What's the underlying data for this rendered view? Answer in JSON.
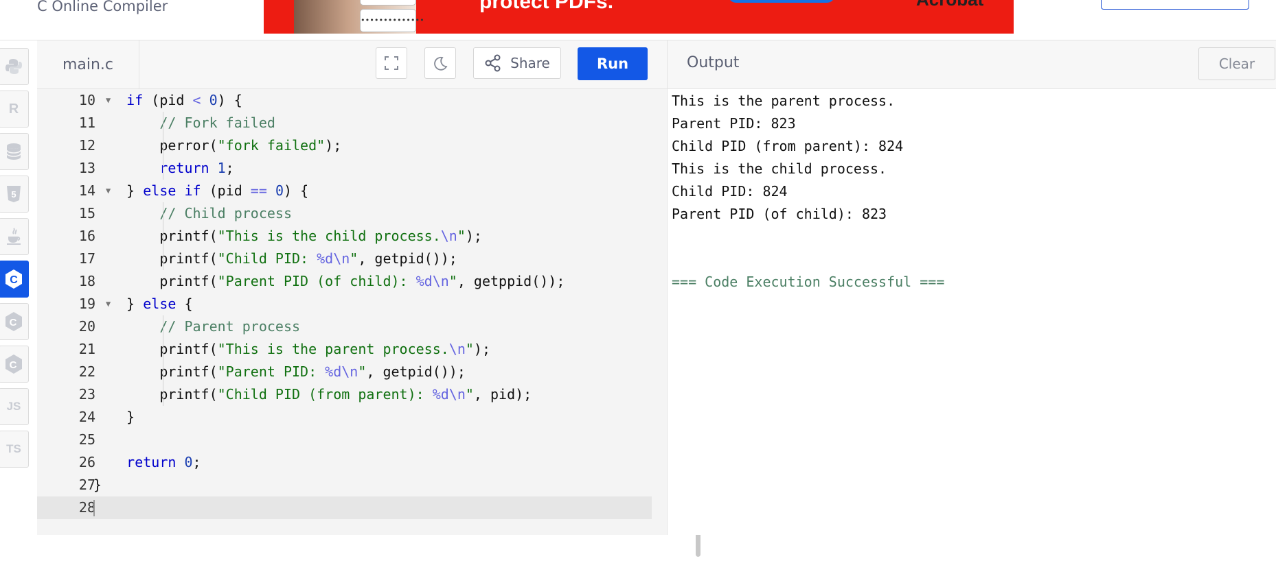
{
  "header": {
    "brand": "C Online Compiler"
  },
  "ad": {
    "headline": "protect PDFs.",
    "brand": "Acrobat",
    "password_mask": "••••••••••••••"
  },
  "sidebar": {
    "items": [
      {
        "name": "python",
        "label": "",
        "active": false
      },
      {
        "name": "r",
        "label": "R",
        "active": false
      },
      {
        "name": "sql",
        "label": "",
        "active": false
      },
      {
        "name": "html",
        "label": "5",
        "active": false
      },
      {
        "name": "java",
        "label": "",
        "active": false
      },
      {
        "name": "c",
        "label": "C",
        "active": true
      },
      {
        "name": "cpp",
        "label": "C",
        "active": false
      },
      {
        "name": "csharp",
        "label": "C",
        "active": false
      },
      {
        "name": "js",
        "label": "JS",
        "active": false
      },
      {
        "name": "ts",
        "label": "TS",
        "active": false
      }
    ]
  },
  "editor": {
    "file_tab": "main.c",
    "share_label": "Share",
    "run_label": "Run",
    "line_numbers": [
      "10",
      "11",
      "12",
      "13",
      "14",
      "15",
      "16",
      "17",
      "18",
      "19",
      "20",
      "21",
      "22",
      "23",
      "24",
      "25",
      "26",
      "27",
      "28"
    ]
  },
  "output": {
    "title": "Output",
    "clear_label": "Clear",
    "lines": [
      "This is the parent process.",
      "Parent PID: 823",
      "Child PID (from parent): 824",
      "This is the child process.",
      "Child PID: 824",
      "Parent PID (of child): 823"
    ],
    "success": "=== Code Execution Successful ==="
  }
}
